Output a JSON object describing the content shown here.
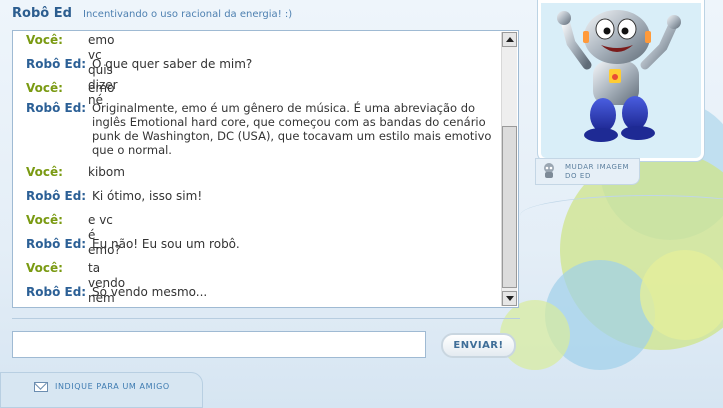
{
  "header": {
    "title": "Robô Ed",
    "subtitle": "Incentivando o uso racional da energia! :)"
  },
  "chat": {
    "messages": [
      {
        "speaker": "Você:",
        "text": "emo vc quis dizer né"
      },
      {
        "speaker": "Robô Ed:",
        "text": "O que quer saber de mim?"
      },
      {
        "speaker": "Você:",
        "text": "emo"
      },
      {
        "speaker": "Robô Ed:",
        "text": "Originalmente, emo é um gênero de música. É uma abreviação do inglês Emotional hard core, que começou com as bandas do cenário punk de Washington, DC (USA), que tocavam um estilo mais emotivo que o normal."
      },
      {
        "speaker": "Você:",
        "text": "kibom"
      },
      {
        "speaker": "Robô Ed:",
        "text": "Ki ótimo, isso sim!"
      },
      {
        "speaker": "Você:",
        "text": "e vc é emo?"
      },
      {
        "speaker": "Robô Ed:",
        "text": "Eu não! Eu sou um robô."
      },
      {
        "speaker": "Você:",
        "text": "ta vendo nem o robô quer ser emo"
      },
      {
        "speaker": "Robô Ed:",
        "text": "Só vendo mesmo..."
      }
    ]
  },
  "input": {
    "value": ""
  },
  "buttons": {
    "send_label": "ENVIAR!",
    "change_image_line1": "MUDAR IMAGEM",
    "change_image_line2": "DO ED"
  },
  "footer": {
    "invite_link": "INDIQUE PARA UM AMIGO"
  },
  "colors": {
    "user_speaker": "#7a9a12",
    "robot_speaker": "#2c6096",
    "accent": "#2c5d8f"
  },
  "icons": [
    "robot-mascot-icon",
    "mail-icon",
    "scroll-up-arrow-icon",
    "scroll-down-arrow-icon"
  ]
}
